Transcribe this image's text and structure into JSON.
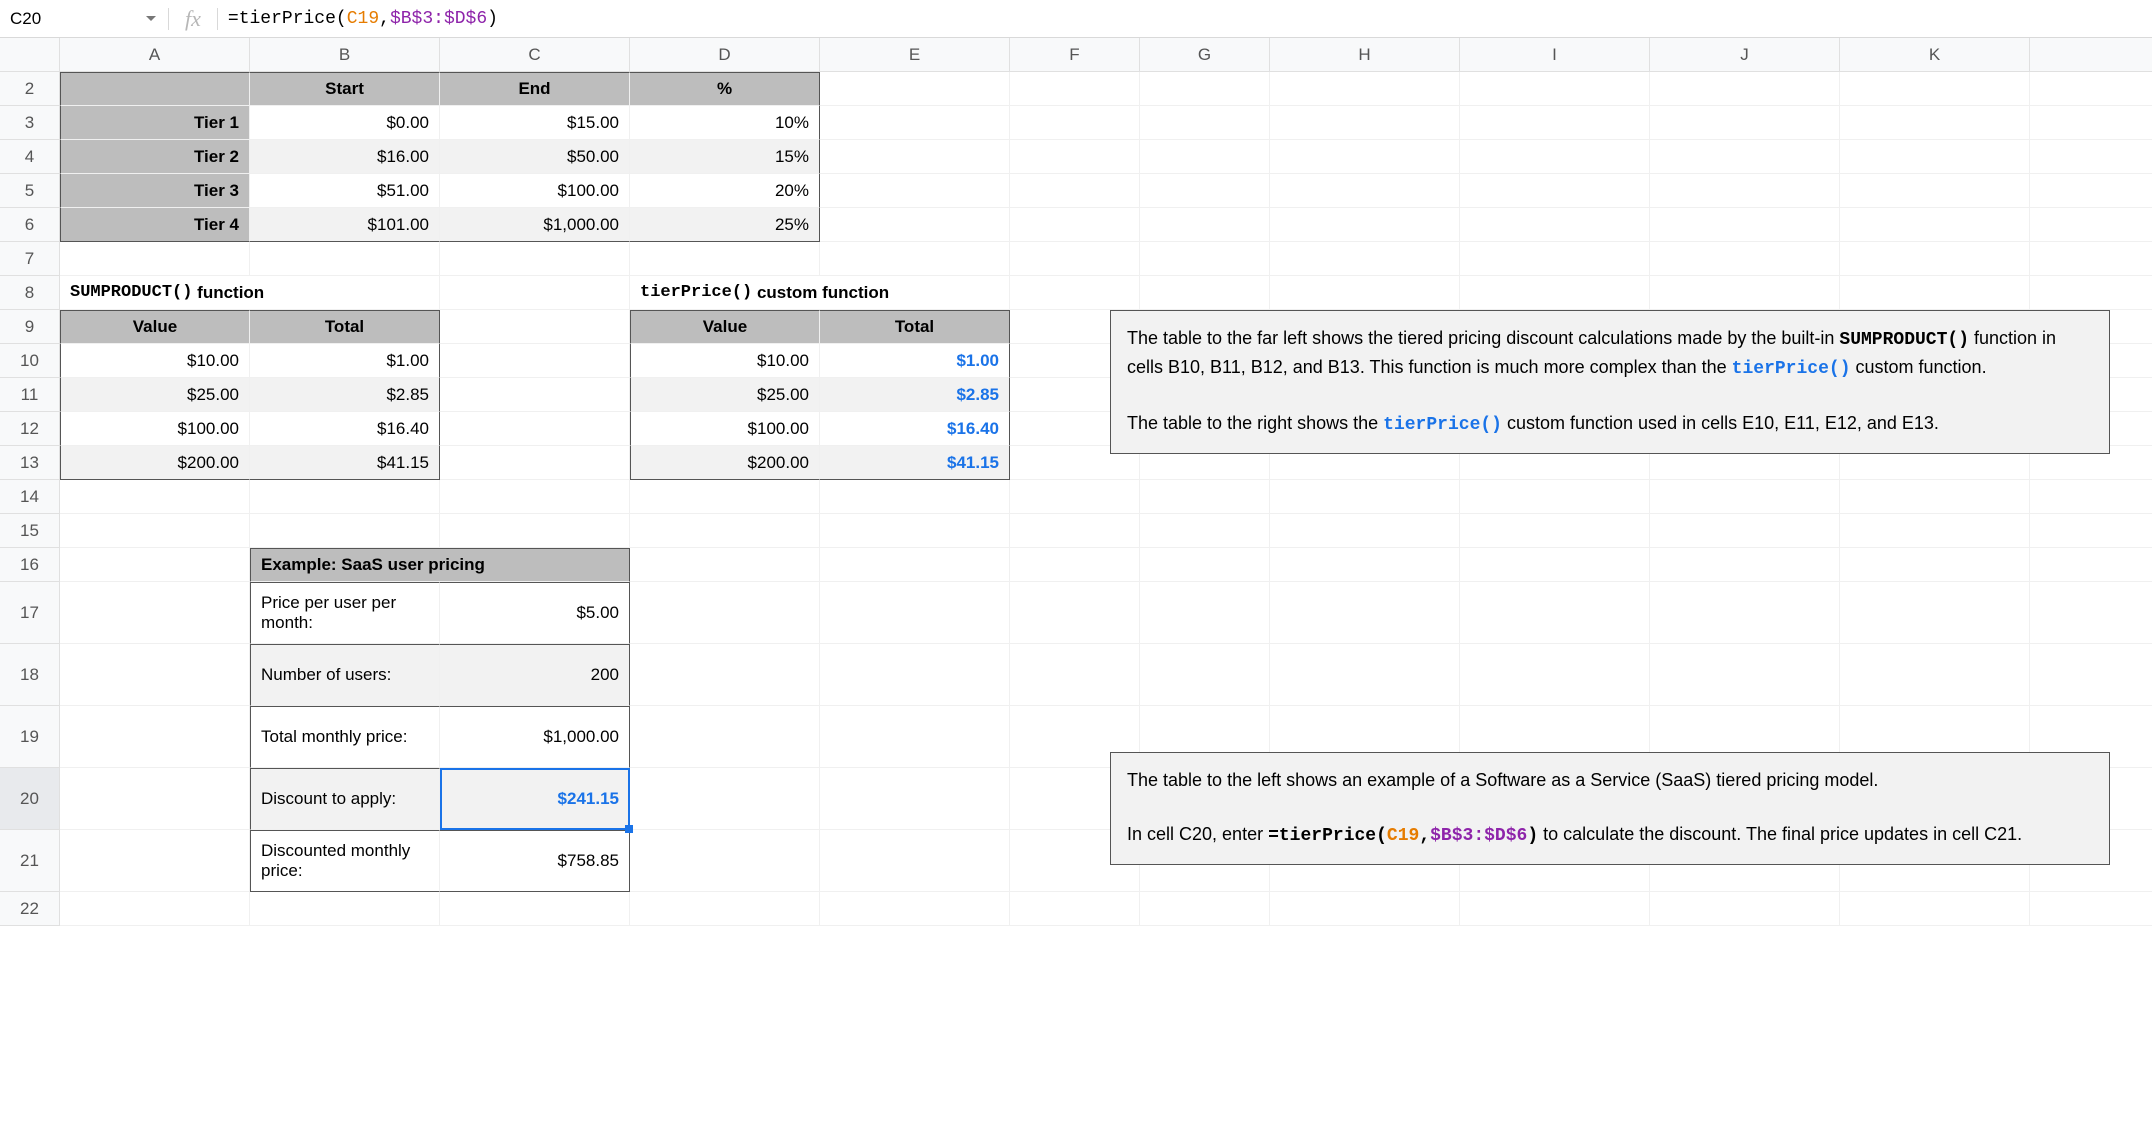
{
  "nameBox": "C20",
  "fxLabel": "fx",
  "formula": {
    "full": "=tierPrice(C19,$B$3:$D$6)",
    "prefix": "=tierPrice(",
    "arg1": "C19",
    "comma": ",",
    "arg2": "$B$3:$D$6",
    "suffix": ")"
  },
  "columns": [
    "A",
    "B",
    "C",
    "D",
    "E",
    "F",
    "G",
    "H",
    "I",
    "J",
    "K"
  ],
  "rowNumbers": [
    "2",
    "3",
    "4",
    "5",
    "6",
    "7",
    "8",
    "9",
    "10",
    "11",
    "12",
    "13",
    "14",
    "15",
    "16",
    "17",
    "18",
    "19",
    "20",
    "21",
    "22"
  ],
  "tierTable": {
    "headers": {
      "start": "Start",
      "end": "End",
      "pct": "%"
    },
    "rows": [
      {
        "label": "Tier 1",
        "start": "$0.00",
        "end": "$15.00",
        "pct": "10%"
      },
      {
        "label": "Tier 2",
        "start": "$16.00",
        "end": "$50.00",
        "pct": "15%"
      },
      {
        "label": "Tier 3",
        "start": "$51.00",
        "end": "$100.00",
        "pct": "20%"
      },
      {
        "label": "Tier 4",
        "start": "$101.00",
        "end": "$1,000.00",
        "pct": "25%"
      }
    ]
  },
  "section1": {
    "titleLeftMono": "SUMPRODUCT()",
    "titleLeftRest": "function",
    "titleRightMono": "tierPrice()",
    "titleRightRest": "custom function",
    "headers": {
      "value": "Value",
      "total": "Total"
    },
    "left": [
      {
        "value": "$10.00",
        "total": "$1.00"
      },
      {
        "value": "$25.00",
        "total": "$2.85"
      },
      {
        "value": "$100.00",
        "total": "$16.40"
      },
      {
        "value": "$200.00",
        "total": "$41.15"
      }
    ],
    "right": [
      {
        "value": "$10.00",
        "total": "$1.00"
      },
      {
        "value": "$25.00",
        "total": "$2.85"
      },
      {
        "value": "$100.00",
        "total": "$16.40"
      },
      {
        "value": "$200.00",
        "total": "$41.15"
      }
    ]
  },
  "saas": {
    "title": "Example: SaaS user pricing",
    "rows": [
      {
        "label": "Price per user per month:",
        "value": "$5.00"
      },
      {
        "label": "Number of users:",
        "value": "200"
      },
      {
        "label": "Total monthly price:",
        "value": "$1,000.00"
      },
      {
        "label": "Discount to apply:",
        "value": "$241.15"
      },
      {
        "label": "Discounted monthly price:",
        "value": "$758.85"
      }
    ]
  },
  "note1": {
    "p1a": "The table to the far left shows the tiered pricing discount calculations made by the built-in ",
    "p1mono1": "SUMPRODUCT()",
    "p1b": " function in cells B10, B11, B12, and B13. This function is much more complex than the ",
    "p1mono2": "tierPrice()",
    "p1c": " custom function.",
    "p2a": "The table to the right shows the ",
    "p2mono": "tierPrice()",
    "p2b": " custom function used in cells E10, E11, E12, and E13."
  },
  "note2": {
    "p1": "The table to the left shows an example of a Software as a Service (SaaS) tiered pricing model.",
    "p2a": "In cell C20, enter ",
    "p2b": " to calculate the discount. The final price updates in cell C21."
  }
}
